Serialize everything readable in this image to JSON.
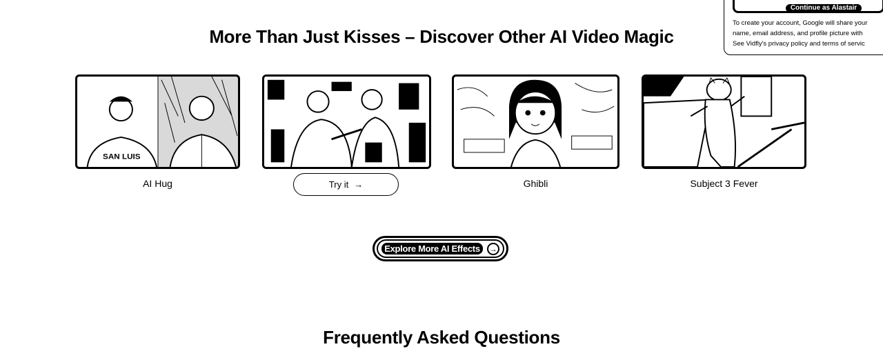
{
  "google_popup": {
    "button_label": "Continue as Alastair",
    "lines": [
      "To create your account, Google will share your",
      "name, email address, and profile picture with",
      "See Vidfly's privacy policy and terms of servic"
    ]
  },
  "effects_section": {
    "title": "More Than Just Kisses – Discover Other AI Video Magic",
    "cards": [
      {
        "label": "AI Hug"
      },
      {
        "label": "",
        "button": "Try it",
        "button_icon": "→"
      },
      {
        "label": "Ghibli"
      },
      {
        "label": "Subject 3 Fever"
      }
    ],
    "explore_label": "Explore More AI Effects",
    "explore_icon": "→"
  },
  "faq": {
    "title": "Frequently Asked Questions"
  }
}
